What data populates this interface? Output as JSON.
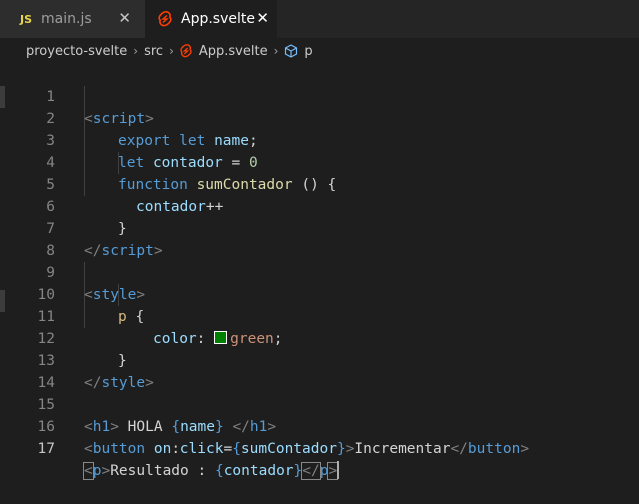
{
  "tabs": [
    {
      "icon_text": "JS",
      "label": "main.js",
      "close": "✕",
      "active": false
    },
    {
      "label": "App.svelte",
      "close": "✕",
      "active": true
    }
  ],
  "breadcrumb": {
    "items": [
      "proyecto-svelte",
      "src",
      "App.svelte",
      "p"
    ],
    "separator": "›"
  },
  "colors": {
    "svelte": "#ff3e00",
    "swatch": "#008000",
    "js": "#e8d44d"
  },
  "code": {
    "lines": [
      "1",
      "2",
      "3",
      "4",
      "5",
      "6",
      "7",
      "8",
      "9",
      "10",
      "11",
      "12",
      "13",
      "14",
      "15",
      "16",
      "17"
    ],
    "t": {
      "lt": "<",
      "gt": ">",
      "close_lt": "</",
      "script": "script",
      "style": "style",
      "h1": "h1",
      "button": "button",
      "p": "p",
      "export": "export",
      "let": "let",
      "name": "name",
      "semi": ";",
      "contador": "contador",
      "eq": " = ",
      "zero": "0",
      "function": "function",
      "sumContador": "sumContador",
      "parens_brace": " () {",
      "plusplus": "++",
      "rbrace": "}",
      "p_sel": "p",
      "lbrace": " {",
      "color_prop": "color",
      "colon": ": ",
      "green": "green",
      "hola": " HOLA ",
      "name_expr_open": "{",
      "name_expr_close": "}",
      "on": "on",
      "click": "click",
      "eq_plain": "=",
      "incrementar": "Incrementar",
      "resultado": "Resultado : "
    }
  }
}
